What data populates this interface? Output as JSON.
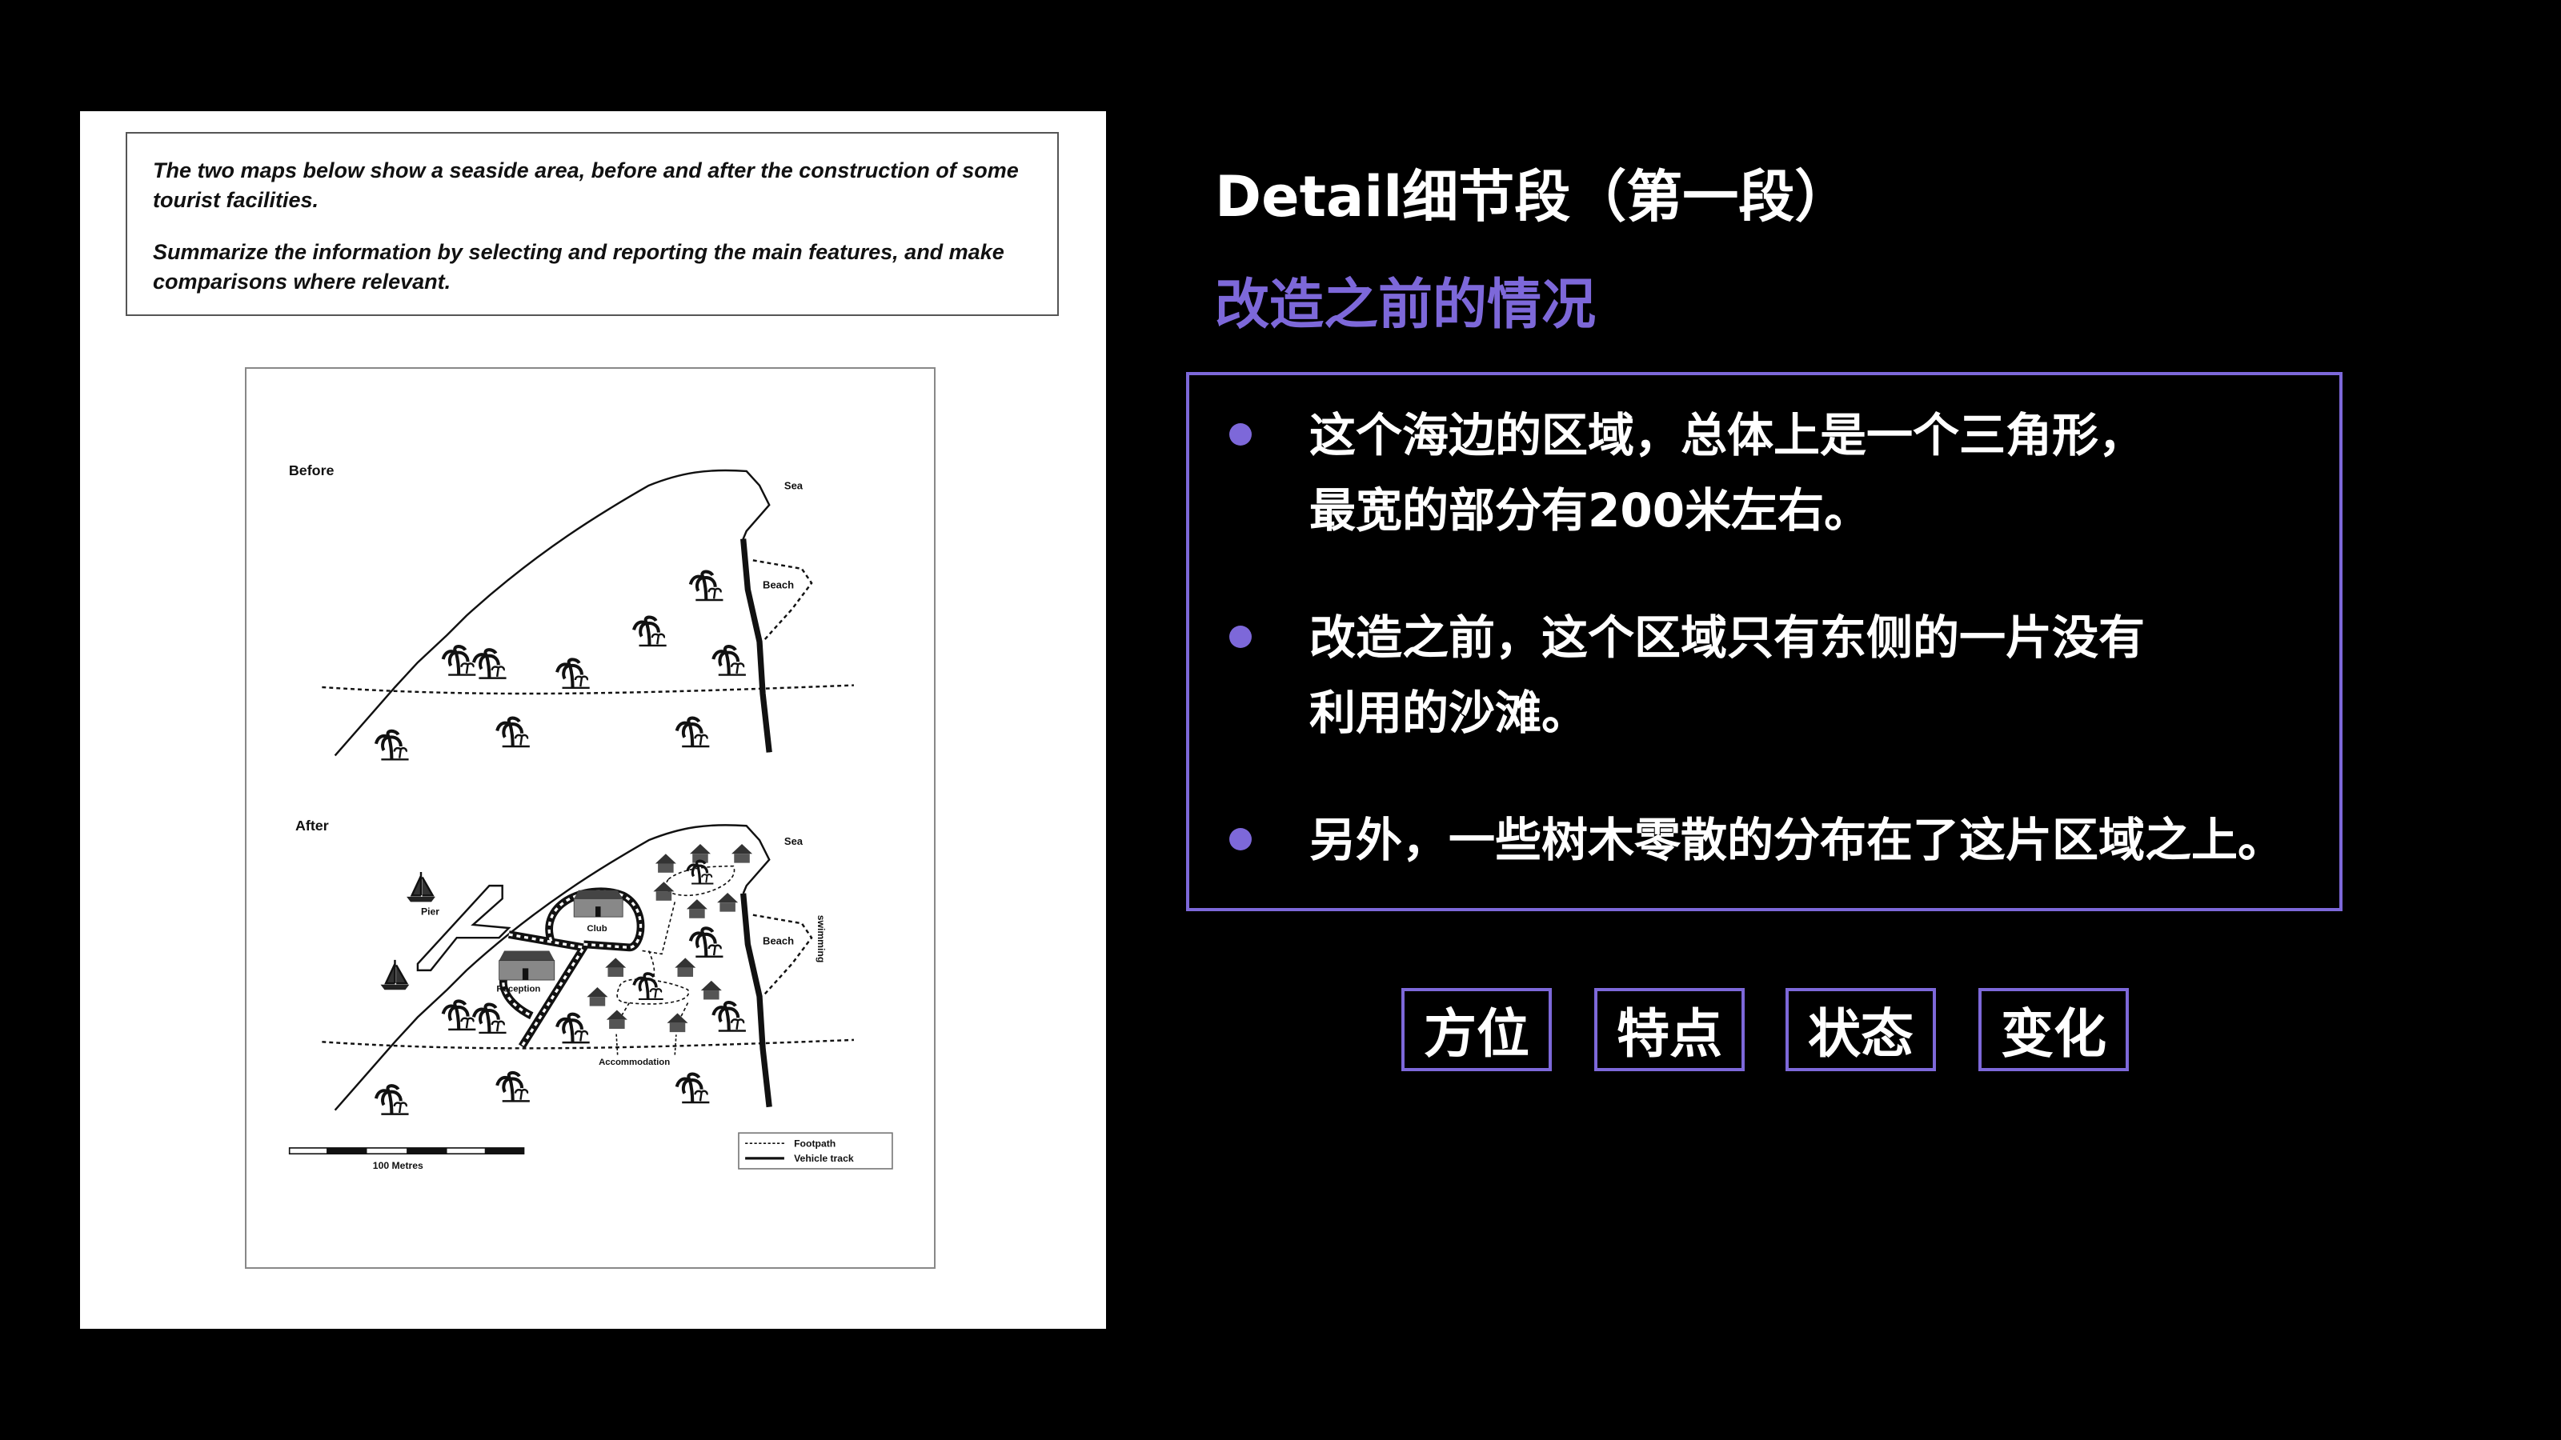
{
  "task": {
    "line1": "The two maps below show a seaside area, before and after the construction of some tourist facilities.",
    "line2": "Summarize the information by selecting and reporting the main features, and make comparisons where relevant."
  },
  "map": {
    "before_label": "Before",
    "after_label": "After",
    "sea": "Sea",
    "beach": "Beach",
    "pier": "Pier",
    "club": "Club",
    "reception": "Reception",
    "swimming": "swimming",
    "accommodation": "Accommodation",
    "legend_footpath": "Footpath",
    "legend_vehicle": "Vehicle track",
    "scale": "100 Metres"
  },
  "slide": {
    "title": "Detail细节段（第一段）",
    "subtitle": "改造之前的情况",
    "bullets": [
      {
        "line1": "这个海边的区域，总体上是一个三角形，",
        "line2": "最宽的部分有200米左右。"
      },
      {
        "line1": "改造之前，这个区域只有东侧的一片没有",
        "line2": "利用的沙滩。"
      },
      {
        "line1": "另外，一些树木零散的分布在了这片区域之上。"
      }
    ],
    "tags": [
      "方位",
      "特点",
      "状态",
      "变化"
    ],
    "accent": "#7d68d9"
  }
}
